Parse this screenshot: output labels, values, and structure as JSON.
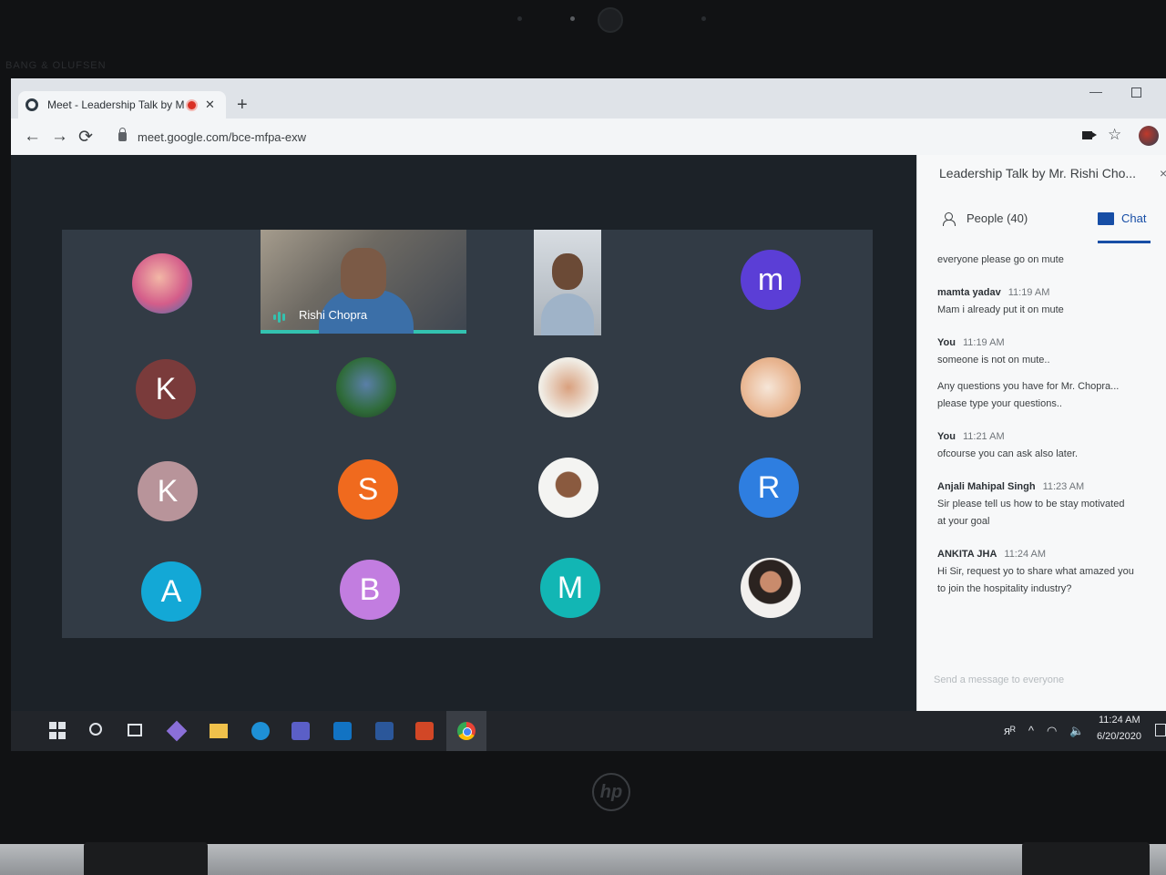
{
  "bezel": {
    "brand": "BANG & OLUFSEN",
    "logo": "hp"
  },
  "browser": {
    "tab_title": "Meet - Leadership Talk by Mr. Rishi Chopra",
    "tab_close": "✕",
    "new_tab": "+",
    "url": "meet.google.com/bce-mfpa-exw",
    "back": "←",
    "forward": "→",
    "reload": "⟳",
    "star": "☆",
    "minimize": "—"
  },
  "meet": {
    "main_video_name": "Rishi Chopra",
    "letter_avatars": [
      {
        "letter": "m",
        "color": "#5b3ed6"
      },
      {
        "letter": "K",
        "color": "#7a3b3b"
      },
      {
        "letter": "K",
        "color": "#b8949a"
      },
      {
        "letter": "S",
        "color": "#f06a1e"
      },
      {
        "letter": "R",
        "color": "#2e7ee0"
      },
      {
        "letter": "A",
        "color": "#13a8d6"
      },
      {
        "letter": "B",
        "color": "#c27de0"
      },
      {
        "letter": "M",
        "color": "#12b6b4"
      }
    ]
  },
  "panel": {
    "title": "Leadership Talk by Mr. Rishi Cho...",
    "close": "×",
    "people_tab": "People (40)",
    "chat_tab": "Chat",
    "messages": [
      {
        "sender": "",
        "time": "",
        "lines": [
          "everyone please go on mute"
        ]
      },
      {
        "sender": "mamta yadav",
        "time": "11:19 AM",
        "lines": [
          "Mam i already put it on mute"
        ]
      },
      {
        "sender": "You",
        "time": "11:19 AM",
        "lines": [
          "someone is not on mute..",
          "",
          "Any questions you have for Mr. Chopra...",
          "please type your questions.."
        ]
      },
      {
        "sender": "You",
        "time": "11:21 AM",
        "lines": [
          "ofcourse you can ask also later."
        ]
      },
      {
        "sender": "Anjali Mahipal Singh",
        "time": "11:23 AM",
        "lines": [
          "Sir please tell us how to be stay motivated",
          "at your goal"
        ]
      },
      {
        "sender": "ANKITA JHA",
        "time": "11:24 AM",
        "lines": [
          "Hi Sir, request yo to share what amazed you",
          "to join the hospitality industry?"
        ]
      }
    ],
    "input_placeholder": "Send a message to everyone"
  },
  "taskbar": {
    "tray_people": "ᴙᴿ",
    "tray_arrow": "^",
    "tray_network": "◠",
    "tray_volume": "🔈",
    "time": "11:24 AM",
    "date": "6/20/2020"
  },
  "icons": [
    "meet-favicon-icon",
    "record-dot-icon",
    "lock-icon",
    "camera-icon",
    "star-icon",
    "people-icon",
    "chat-icon",
    "windows-start-icon",
    "search-icon",
    "task-view-icon",
    "chrome-icon"
  ]
}
